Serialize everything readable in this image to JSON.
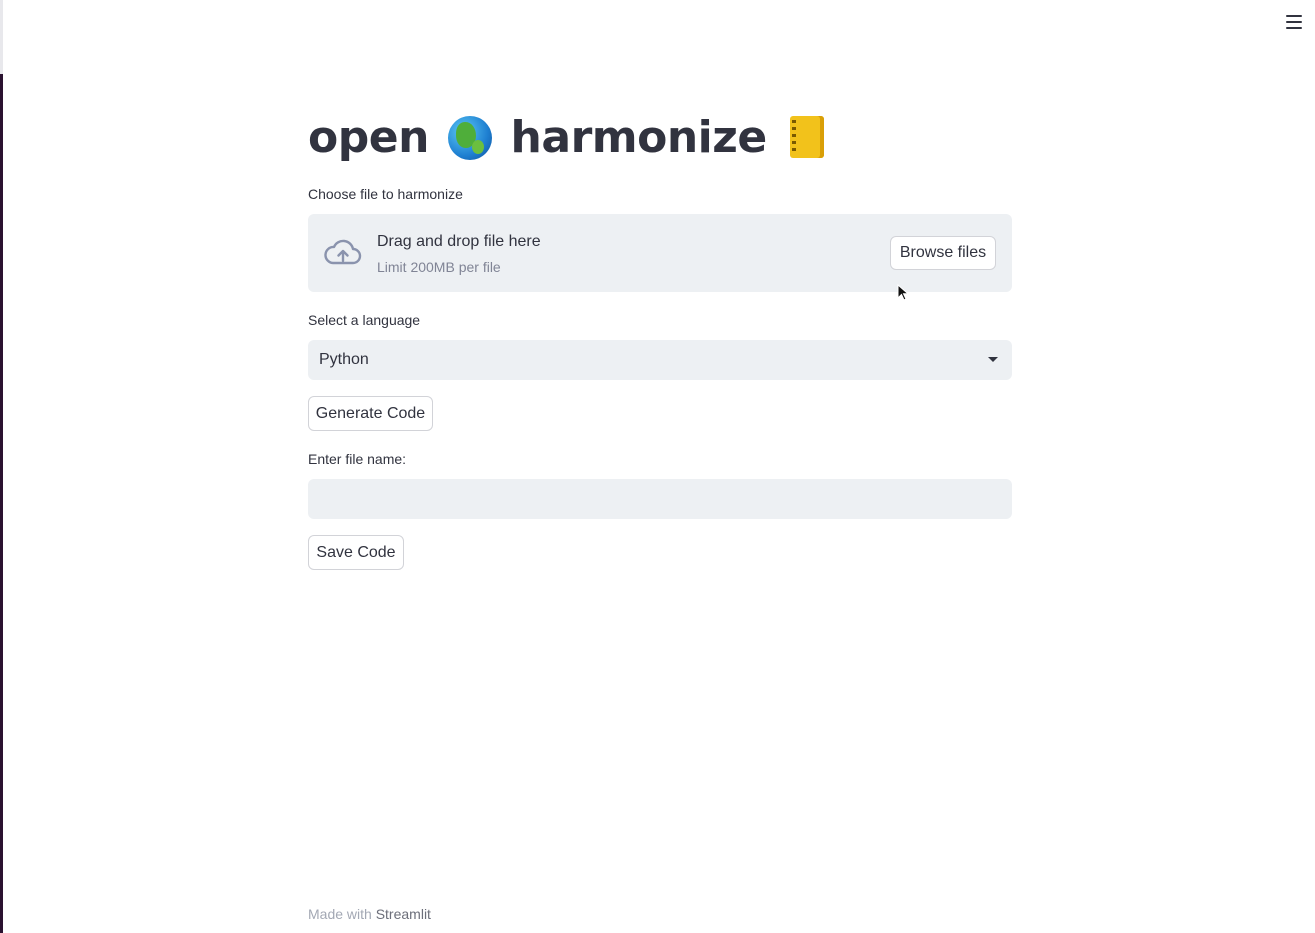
{
  "app": {
    "title_word1": "open",
    "title_word2": "harmonize",
    "title_icons": [
      "globe-emoji",
      "notebook-emoji"
    ]
  },
  "menu": {
    "icon": "hamburger-menu-icon"
  },
  "uploader": {
    "label": "Choose file to harmonize",
    "drop_text": "Drag and drop file here",
    "limit_text": "Limit 200MB per file",
    "browse_label": "Browse files",
    "icon": "cloud-upload-icon"
  },
  "language": {
    "label": "Select a language",
    "selected": "Python"
  },
  "generate": {
    "label": "Generate Code"
  },
  "filename": {
    "label": "Enter file name:",
    "value": ""
  },
  "save": {
    "label": "Save Code"
  },
  "footer": {
    "prefix": "Made with",
    "brand": "Streamlit"
  },
  "colors": {
    "text": "#31333f",
    "widget_bg": "#edf0f3",
    "muted": "#808495"
  }
}
